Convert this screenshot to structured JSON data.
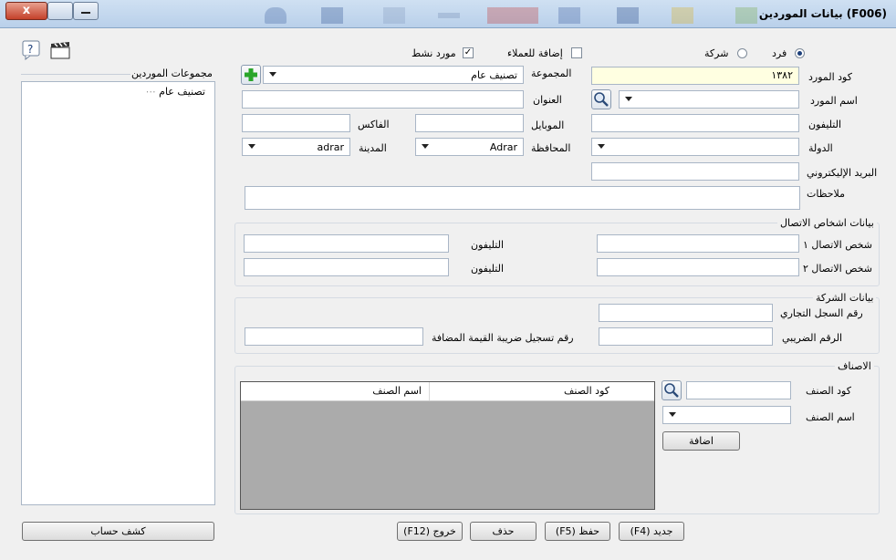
{
  "window": {
    "title": "(F006)  بيانات الموردين",
    "close_glyph": "x"
  },
  "tree_panel": {
    "title": "مجموعات الموردين",
    "items": [
      "تصنيف عام"
    ],
    "statement_button": "كشف حساب"
  },
  "type_row": {
    "individual": "فرد",
    "company": "شركة",
    "add_to_customers": "إضافة للعملاء",
    "active_supplier": "مورد نشط",
    "active_checked": "✓"
  },
  "form": {
    "code_label": "كود المورد",
    "code_value": "١٣٨٢",
    "group_label": "المجموعة",
    "group_value": "تصنيف عام",
    "name_label": "اسم المورد",
    "name_value": "",
    "address_label": "العنوان",
    "address_value": "",
    "phone_label": "التليفون",
    "mobile_label": "الموبايل",
    "fax_label": "الفاكس",
    "country_label": "الدولة",
    "country_value": "",
    "governorate_label": "المحافظة",
    "governorate_value": "Adrar",
    "city_label": "المدينة",
    "city_value": "adrar",
    "email_label": "البريد الإليكتروني",
    "notes_label": "ملاحظات"
  },
  "contacts": {
    "title": "بيانات اشخاص الاتصال",
    "contact1_label": "شخص الاتصال ١",
    "contact2_label": "شخص الاتصال ٢",
    "phone1_label": "التليفون",
    "phone2_label": "التليفون"
  },
  "company": {
    "title": "بيانات الشركة",
    "commercial_reg_label": "رقم السجل التجاري",
    "tax_number_label": "الرقم الضريبي",
    "vat_reg_label": "رقم تسجيل ضريبة القيمة المضافة"
  },
  "items": {
    "title": "الاصناف",
    "item_code_label": "كود الصنف",
    "item_name_label": "اسم الصنف",
    "add_button": "اضافة",
    "grid_columns": [
      "كود الصنف",
      "اسم الصنف"
    ]
  },
  "footer": {
    "new": "جديد (F4)",
    "save": "حفظ (F5)",
    "delete": "حذف",
    "exit": "خروج (F12)"
  },
  "colors": {
    "code_field_bg": "#ffffe1",
    "title_gradient_top": "#cfe0f2",
    "add_group_green": "#2aa52a"
  },
  "icons": {
    "help": "help-icon",
    "clapper": "clapperboard-icon",
    "search": "magnifier-icon",
    "add_group": "plus-icon"
  }
}
